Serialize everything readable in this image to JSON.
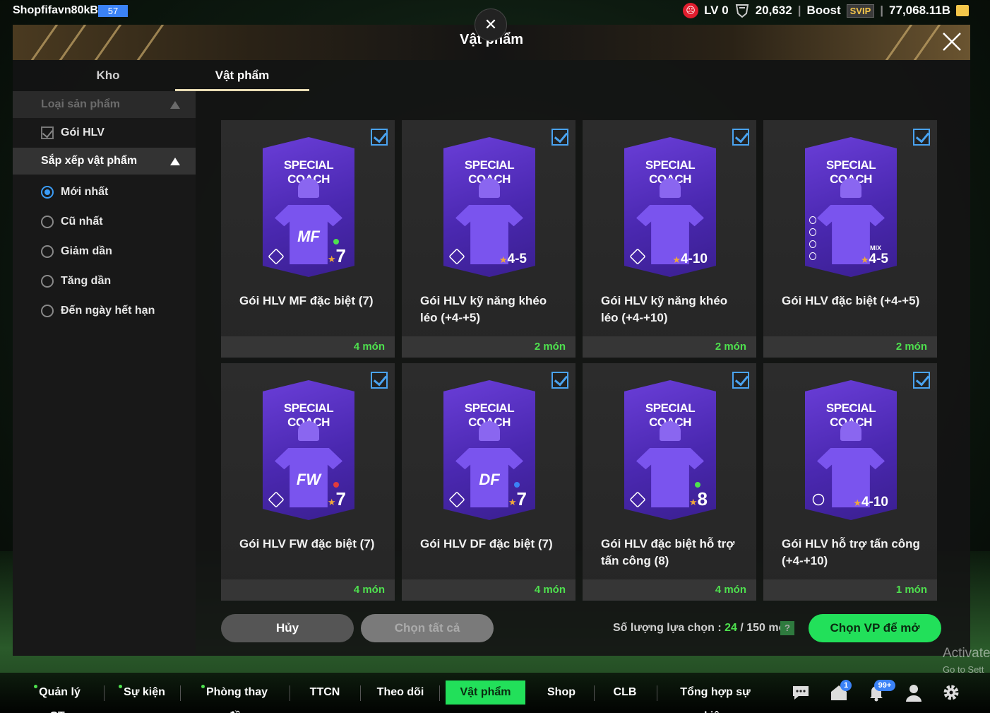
{
  "topbar": {
    "username": "Shopfifavn80kB",
    "level": "57",
    "lv": "LV 0",
    "score": "20,632",
    "boost": "Boost",
    "svip": "SVIP",
    "currency": "77,068.11B"
  },
  "window": {
    "title": "Vật phẩm",
    "tabs": [
      {
        "label": "Kho"
      },
      {
        "label": "Vật phẩm"
      }
    ]
  },
  "sidebar": {
    "filter_header": "Loại sản phẩm",
    "filter_item": "Gói HLV",
    "sort_header": "Sắp xếp vật phẩm",
    "sort_options": [
      {
        "label": "Mới nhất"
      },
      {
        "label": "Cũ nhất"
      },
      {
        "label": "Giảm dần"
      },
      {
        "label": "Tăng dần"
      },
      {
        "label": "Đến ngày hết hạn"
      }
    ]
  },
  "cards": [
    {
      "pack_title": "SPECIAL COACH",
      "pos": "MF",
      "level": "7",
      "star": "★",
      "name": "Gói HLV MF đặc biệt (7)",
      "count": "4 món"
    },
    {
      "pack_title": "SPECIAL COACH",
      "pos": "",
      "level": "4-5",
      "star": "★",
      "name": "Gói HLV kỹ năng khéo léo (+4-+5)",
      "count": "2 món"
    },
    {
      "pack_title": "SPECIAL COACH",
      "pos": "",
      "level": "4-10",
      "star": "★",
      "name": "Gói HLV kỹ năng khéo léo (+4-+10)",
      "count": "2 món"
    },
    {
      "pack_title": "SPECIAL COACH",
      "pos": "",
      "level": "4-5",
      "mix": "MIX",
      "star": "★",
      "name": "Gói HLV đặc biệt (+4-+5)",
      "count": "2 món"
    },
    {
      "pack_title": "SPECIAL COACH",
      "pos": "FW",
      "level": "7",
      "star": "★",
      "name": "Gói HLV FW đặc biệt (7)",
      "count": "4 món"
    },
    {
      "pack_title": "SPECIAL COACH",
      "pos": "DF",
      "level": "7",
      "star": "★",
      "name": "Gói HLV DF đặc biệt (7)",
      "count": "4 món"
    },
    {
      "pack_title": "SPECIAL COACH",
      "pos": "",
      "level": "8",
      "star": "★",
      "name": "Gói HLV đặc biệt hỗ trợ tấn công (8)",
      "count": "4 món"
    },
    {
      "pack_title": "SPECIAL COACH",
      "pos": "",
      "level": "4-10",
      "star": "★",
      "name": "Gói HLV hỗ trợ tấn công (+4-+10)",
      "count": "1 món"
    }
  ],
  "actions": {
    "cancel": "Hủy",
    "select_all": "Chọn tất cả",
    "selection_prefix": "Số lượng lựa chọn : ",
    "selection_count": "24",
    "selection_suffix": " / 150 món",
    "help": "?",
    "open": "Chọn VP để mở"
  },
  "watermark": {
    "line1": "Activate",
    "line2": "Go to Sett"
  },
  "nav": {
    "items": [
      {
        "label": "Quản lý CT"
      },
      {
        "label": "Sự kiện"
      },
      {
        "label": "Phòng thay đồ"
      },
      {
        "label": "TTCN"
      },
      {
        "label": "Theo dõi"
      },
      {
        "label": "Vật phẩm"
      },
      {
        "label": "Shop"
      },
      {
        "label": "CLB"
      },
      {
        "label": "Tổng hợp sự kiện"
      }
    ],
    "badge_home": "1",
    "badge_bell": "99+"
  },
  "colors": {
    "accent_green": "#22e05a",
    "count_green": "#4ee04e",
    "check_blue": "#4aa3f0",
    "pack_purple": "#5a32c8"
  }
}
